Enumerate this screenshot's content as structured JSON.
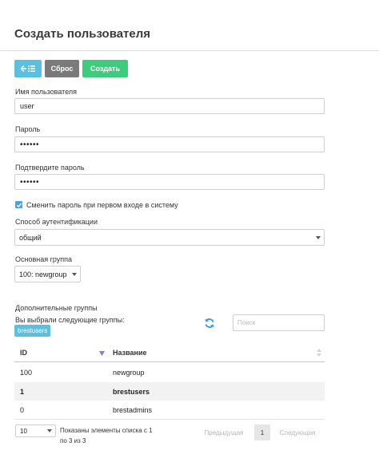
{
  "page": {
    "title": "Создать пользователя"
  },
  "toolbar": {
    "back_icon": "arrow-left-list-icon",
    "reset_label": "Сброс",
    "create_label": "Создать",
    "colors": {
      "back": "#5bc0de",
      "reset": "#7a7a7a",
      "create": "#3dcc7e"
    }
  },
  "form": {
    "username": {
      "label": "Имя пользователя",
      "value": "user"
    },
    "password": {
      "label": "Пароль",
      "value": "••••••"
    },
    "confirm_password": {
      "label": "Подтвердите пароль",
      "value": "••••••"
    },
    "change_password": {
      "label": "Сменить пароль при первом входе в систему",
      "checked": true
    },
    "auth_method": {
      "label": "Способ аутентификации",
      "value": "общий"
    },
    "primary_group": {
      "label": "Основная группа",
      "value": "100: newgroup"
    },
    "additional_groups": {
      "label": "Дополнительные группы",
      "selected_text": "Вы выбрали следующие группы:",
      "selected": [
        "brestusers"
      ],
      "refresh_icon": "refresh-icon",
      "search_placeholder": "Поиск"
    }
  },
  "table": {
    "columns": [
      "ID",
      "Название"
    ],
    "rows": [
      {
        "id": "100",
        "name": "newgroup"
      },
      {
        "id": "1",
        "name": "brestusers"
      },
      {
        "id": "0",
        "name": "brestadmins"
      }
    ],
    "selected_row": 1
  },
  "footer": {
    "page_size": "10",
    "info_line1": "Показаны элементы списка с 1",
    "info_line2": "по 3 из 3",
    "prev_label": "Предыдущая",
    "current_page": "1",
    "next_label": "Следующая"
  }
}
